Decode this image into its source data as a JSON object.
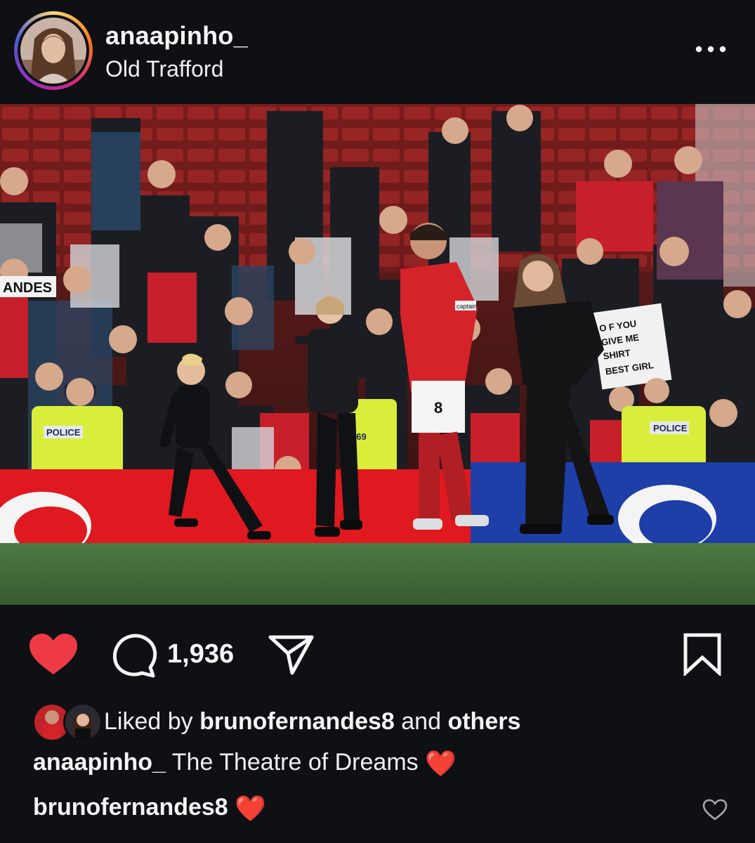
{
  "post": {
    "username": "anaapinho_",
    "location": "Old Trafford"
  },
  "photo": {
    "board_labels": [
      "POLICE",
      "POLICE",
      "169"
    ],
    "banner_text": "ANDES",
    "sign_lines": [
      "O F YOU",
      "GIVE ME",
      "SHIRT",
      "BEST GIRL"
    ],
    "jersey_number": "8",
    "captain_band": "captain"
  },
  "actions": {
    "comment_count": "1,936"
  },
  "likes": {
    "prefix": "Liked by",
    "user": "brunofernandes8",
    "joiner": "and",
    "others": "others"
  },
  "caption": {
    "username": "anaapinho_",
    "text": "The Theatre of Dreams",
    "emoji": "❤️"
  },
  "comment": {
    "username": "brunofernandes8",
    "emoji": "❤️"
  },
  "colors": {
    "background": "#0e1014",
    "like_red": "#ed3a45",
    "text": "#f5f5f5"
  }
}
